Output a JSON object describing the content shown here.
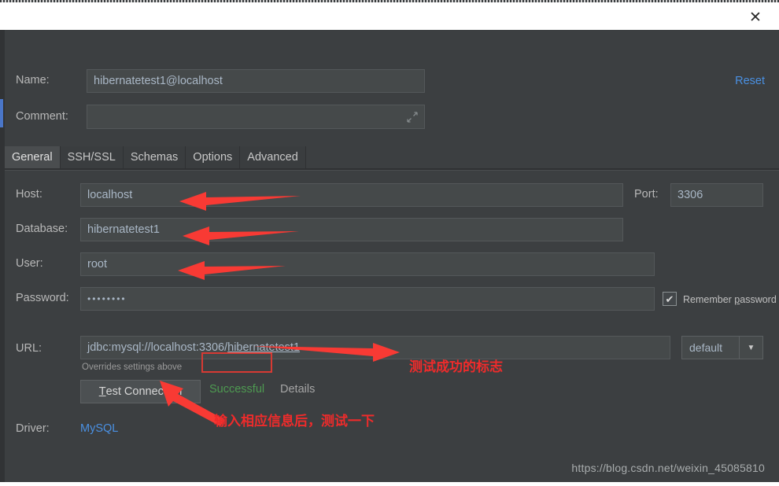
{
  "window": {
    "close_icon": "close-icon",
    "close_glyph": "✕"
  },
  "header": {
    "name_label": "Name:",
    "name_value": "hibernatetest1@localhost",
    "comment_label": "Comment:",
    "comment_value": "",
    "comment_placeholder": "",
    "expand_icon": "expand-icon",
    "reset_label": "Reset"
  },
  "tabs": [
    {
      "label": "General",
      "active": true
    },
    {
      "label": "SSH/SSL",
      "active": false
    },
    {
      "label": "Schemas",
      "active": false
    },
    {
      "label": "Options",
      "active": false
    },
    {
      "label": "Advanced",
      "active": false
    }
  ],
  "general": {
    "host_label": "Host:",
    "host_value": "localhost",
    "port_label": "Port:",
    "port_value": "3306",
    "database_label": "Database:",
    "database_value": "hibernatetest1",
    "user_label": "User:",
    "user_value": "root",
    "password_label": "Password:",
    "password_value": "••••••••",
    "remember_password_label_pre": "Remember ",
    "remember_password_label_key": "p",
    "remember_password_label_post": "assword",
    "remember_password_checked": true,
    "checkbox_glyph": "✔",
    "url_label": "URL:",
    "url_value_plain": "jdbc:mysql://localhost:3306/",
    "url_value_underlined": "hibernatetest1",
    "overrides_note": "Overrides settings above",
    "dropdown_value": "default",
    "dropdown_caret": "▼",
    "test_button_key": "T",
    "test_button_rest": "est Connection",
    "status_text": "Successful",
    "details_label": "Details",
    "driver_label": "Driver:",
    "driver_value": "MySQL"
  },
  "annotations": {
    "success_note": "测试成功的标志",
    "test_note": "输入相应信息后，测试一下",
    "arrow_color": "#f83a34",
    "box_color": "#d73a33"
  },
  "watermark": {
    "text": "https://blog.csdn.net/weixin_45085810"
  },
  "colors": {
    "dialog_bg": "#3c3f41",
    "field_bg": "#45494a",
    "accent_blue": "#4a90e2",
    "success_green": "#4e9a51",
    "left_accent": "#4a76c8"
  }
}
